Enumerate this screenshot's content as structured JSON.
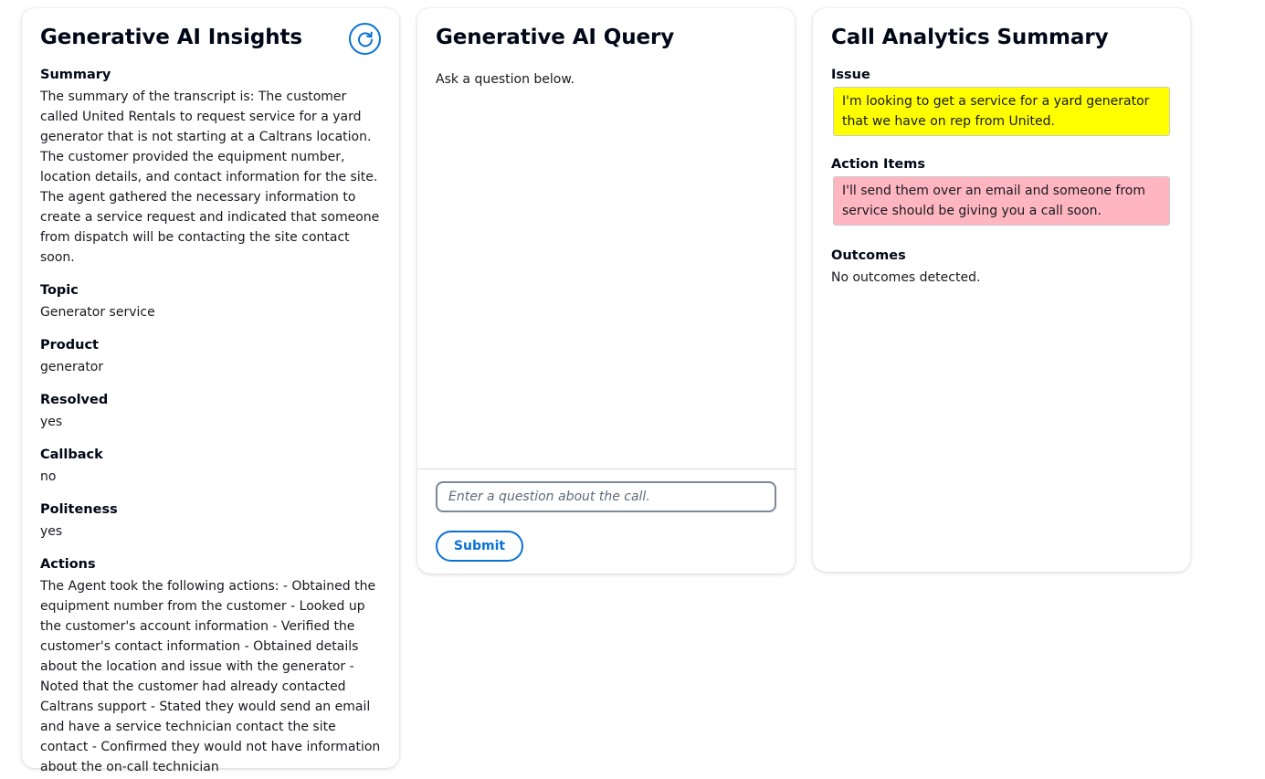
{
  "insights": {
    "title": "Generative AI Insights",
    "refresh_icon": "refresh-icon",
    "fields": [
      {
        "label": "Summary",
        "value": "The summary of the transcript is: The customer called United Rentals to request service for a yard generator that is not starting at a Caltrans location. The customer provided the equipment number, location details, and contact information for the site. The agent gathered the necessary information to create a service request and indicated that someone from dispatch will be contacting the site contact soon."
      },
      {
        "label": "Topic",
        "value": "Generator service"
      },
      {
        "label": "Product",
        "value": "generator"
      },
      {
        "label": "Resolved",
        "value": "yes"
      },
      {
        "label": "Callback",
        "value": "no"
      },
      {
        "label": "Politeness",
        "value": "yes"
      },
      {
        "label": "Actions",
        "value": "The Agent took the following actions: - Obtained the equipment number from the customer - Looked up the customer's account information - Verified the customer's contact information - Obtained details about the location and issue with the generator - Noted that the customer had already contacted Caltrans support - Stated they would send an email and have a service technician contact the site contact - Confirmed they would not have information about the on-call technician"
      }
    ]
  },
  "query": {
    "title": "Generative AI Query",
    "hint": "Ask a question below.",
    "input_value": "",
    "input_placeholder": "Enter a question about the call.",
    "submit_label": "Submit"
  },
  "analytics": {
    "title": "Call Analytics Summary",
    "issue_label": "Issue",
    "issue_text": "I'm looking to get a service for a yard generator that we have on rep from United.",
    "action_items_label": "Action Items",
    "action_items_text": "I'll send them over an email and someone from service should be giving you a call soon.",
    "outcomes_label": "Outcomes",
    "outcomes_text": "No outcomes detected."
  },
  "colors": {
    "accent": "#0972d3",
    "issue_highlight": "#ffff00",
    "action_highlight": "#ffb6c1"
  }
}
